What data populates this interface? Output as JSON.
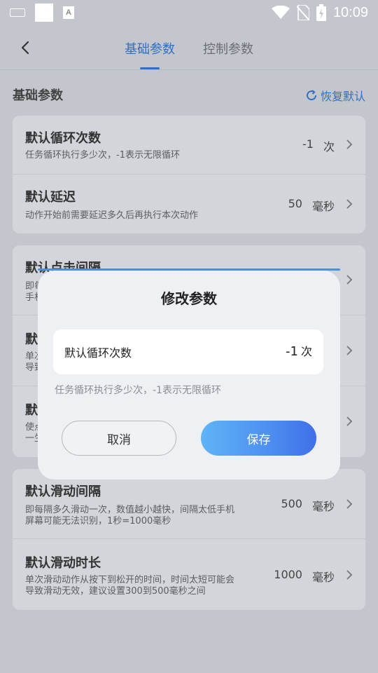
{
  "status_bar": {
    "time": "10:09",
    "a_icon_text": "A"
  },
  "nav": {
    "tabs": [
      {
        "label": "基础参数",
        "active": true
      },
      {
        "label": "控制参数",
        "active": false
      }
    ]
  },
  "section": {
    "title": "基础参数",
    "restore_label": "恢复默认"
  },
  "card1": {
    "rows": [
      {
        "title": "默认循环次数",
        "desc": "任务循环执行多少次，-1表示无限循环",
        "value": "-1",
        "unit": "次"
      },
      {
        "title": "默认延迟",
        "desc": "动作开始前需要延迟多久后再执行本次动作",
        "value": "50",
        "unit": "毫秒"
      }
    ]
  },
  "card2": {
    "rows": [
      {
        "title": "默认点击间隔",
        "desc_line1": "即每",
        "desc_line2": "手机"
      },
      {
        "title": "默认",
        "desc_line1": "单次",
        "desc_line2": "导致"
      },
      {
        "title": "默认",
        "desc_line1": "使点",
        "desc_line2": "一生"
      }
    ]
  },
  "card3": {
    "rows": [
      {
        "title": "默认滑动间隔",
        "desc_line1": "即每隔多久滑动一次，数值越小越快，间隔太低手机",
        "desc_line2": "屏幕可能无法识别，1秒=1000毫秒",
        "value": "500",
        "unit": "毫秒"
      },
      {
        "title": "默认滑动时长",
        "desc_line1": "单次滑动动作从按下到松开的时间，时间太短可能会",
        "desc_line2": "导致滑动无效，建议设置300到500毫秒之间",
        "value": "1000",
        "unit": "毫秒"
      }
    ]
  },
  "dialog": {
    "title": "修改参数",
    "field_label": "默认循环次数",
    "field_value": "-1",
    "field_unit": "次",
    "desc": "任务循环执行多少次，-1表示无限循环",
    "cancel_label": "取消",
    "save_label": "保存"
  },
  "colors": {
    "accent": "#2f6fc4",
    "save_gradient_start": "#5fb4f6",
    "save_gradient_end": "#3f6fe8"
  }
}
